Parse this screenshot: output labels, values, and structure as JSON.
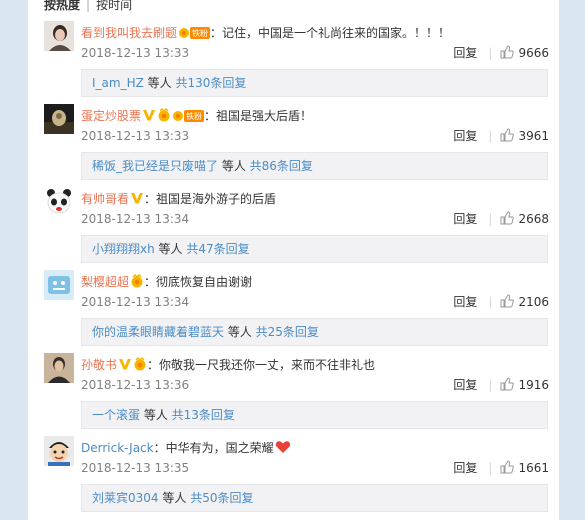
{
  "sort": {
    "hot": "按热度",
    "time": "按时间"
  },
  "reply_label": "回复",
  "comments": [
    {
      "user": "看到我叫我去刷题",
      "sep": "：",
      "text": "记住，中国是一个礼尚往来的国家。！！！",
      "time": "2018-12-13 13:33",
      "likes": "9666",
      "sub_user": "I_am_HZ",
      "sub_mid": " 等人 ",
      "sub_count": "共130条回复",
      "badges": [
        "iron-fan"
      ],
      "name_color": "orange"
    },
    {
      "user": "蛋定炒股票",
      "sep": "：",
      "text": "祖国是强大后盾！",
      "time": "2018-12-13 13:33",
      "likes": "3961",
      "sub_user": "稀饭_我已经是只废喵了",
      "sub_mid": " 等人 ",
      "sub_count": "共86条回复",
      "badges": [
        "verified-v",
        "fan",
        "iron-fan"
      ],
      "name_color": "orange"
    },
    {
      "user": "有帅哥看",
      "sep": "：",
      "text": "祖国是海外游子的后盾",
      "time": "2018-12-13 13:34",
      "likes": "2668",
      "sub_user": "小翔翔翔xh",
      "sub_mid": " 等人 ",
      "sub_count": "共47条回复",
      "badges": [
        "verified-v"
      ],
      "name_color": "orange"
    },
    {
      "user": "梨樱超超",
      "sep": "：",
      "text": "彻底恢复自由谢谢",
      "time": "2018-12-13 13:34",
      "likes": "2106",
      "sub_user": "你的温柔眼睛藏着碧蓝天",
      "sub_mid": " 等人 ",
      "sub_count": "共25条回复",
      "badges": [
        "fan"
      ],
      "name_color": "orange"
    },
    {
      "user": "孙敬书",
      "sep": "：",
      "text": "你敬我一尺我还你一丈，来而不往非礼也",
      "time": "2018-12-13 13:36",
      "likes": "1916",
      "sub_user": "一个滚蛋",
      "sub_mid": " 等人 ",
      "sub_count": "共13条回复",
      "badges": [
        "verified-v",
        "fan"
      ],
      "name_color": "orange"
    },
    {
      "user": "Derrick-Jack",
      "sep": "：",
      "text": "中华有为，国之荣耀",
      "time": "2018-12-13 13:35",
      "likes": "1661",
      "sub_user": "刘莱宾0304",
      "sub_mid": " 等人 ",
      "sub_count": "共50条回复",
      "badges": [
        "heart-emoji"
      ],
      "name_color": "blue"
    }
  ]
}
